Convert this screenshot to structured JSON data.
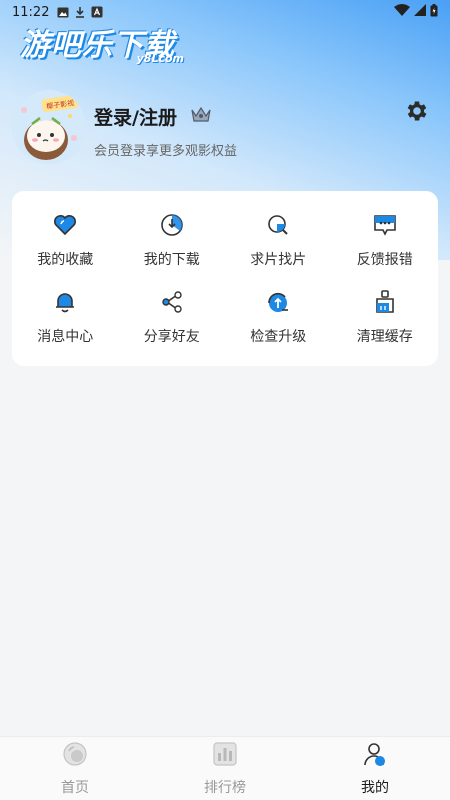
{
  "status_bar": {
    "time": "11:22"
  },
  "brand": {
    "title": "游吧乐下载",
    "subtitle": "y8Lcom"
  },
  "profile": {
    "login_title": "登录/注册",
    "login_subtitle": "会员登录享更多观影权益",
    "avatar_text": "椰子影视"
  },
  "menu": {
    "items": [
      {
        "label": "我的收藏",
        "icon": "heart-icon"
      },
      {
        "label": "我的下载",
        "icon": "download-icon"
      },
      {
        "label": "求片找片",
        "icon": "search-film-icon"
      },
      {
        "label": "反馈报错",
        "icon": "feedback-icon"
      },
      {
        "label": "消息中心",
        "icon": "bell-icon"
      },
      {
        "label": "分享好友",
        "icon": "share-icon"
      },
      {
        "label": "检查升级",
        "icon": "upgrade-icon"
      },
      {
        "label": "清理缓存",
        "icon": "clean-icon"
      }
    ]
  },
  "tabbar": {
    "tabs": [
      {
        "label": "首页",
        "icon": "home-icon",
        "active": false
      },
      {
        "label": "排行榜",
        "icon": "ranking-icon",
        "active": false
      },
      {
        "label": "我的",
        "icon": "profile-icon",
        "active": true
      }
    ]
  },
  "colors": {
    "accent": "#1e88e5",
    "icon_dark": "#333333",
    "active_tab": "#1a1a1a",
    "inactive_tab": "#999999"
  }
}
